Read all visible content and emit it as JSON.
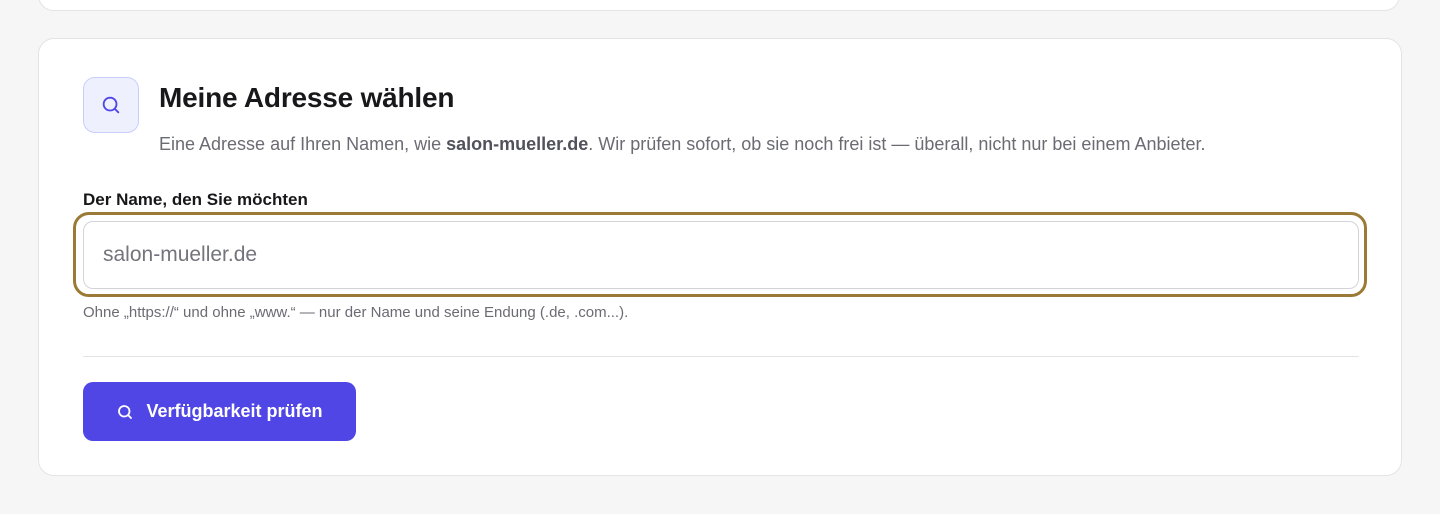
{
  "section": {
    "icon": "search-icon",
    "title": "Meine Adresse wählen",
    "description_before": "Eine Adresse auf Ihren Namen, wie ",
    "description_example": "salon-mueller.de",
    "description_after": ". Wir prüfen sofort, ob sie noch frei ist — überall, nicht nur bei einem Anbieter."
  },
  "domain_field": {
    "label": "Der Name, den Sie möchten",
    "value": "",
    "placeholder": "salon-mueller.de",
    "hint": "Ohne „https://“ und ohne „www.“ — nur der Name und seine Endung (.de, .com...)."
  },
  "check_button": {
    "icon": "search-icon",
    "label": "Verfügbarkeit prüfen"
  },
  "colors": {
    "accent": "#4f46e5",
    "focus_ring": "#9a7a35",
    "icon_tint": "#4f46e5",
    "icon_background": "#eef0fe"
  }
}
